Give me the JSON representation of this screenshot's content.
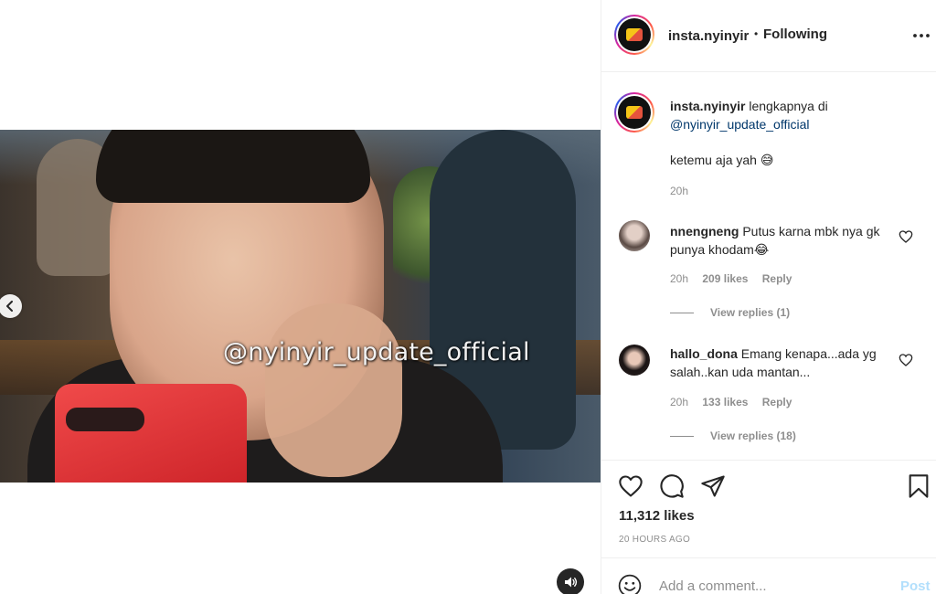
{
  "post": {
    "username": "insta.nyinyir",
    "following_label": "Following",
    "separator": "•",
    "video_watermark": "@nyinyir_update_official"
  },
  "caption": {
    "username": "insta.nyinyir",
    "text_before": "lengkapnya di",
    "mention": "@nyinyir_update_official",
    "line2": "ketemu aja yah 😅",
    "time": "20h"
  },
  "comments": [
    {
      "username": "nnengneng",
      "text": "Putus karna mbk nya gk punya khodam😂",
      "time": "20h",
      "likes": "209 likes",
      "reply_label": "Reply",
      "view_replies": "View replies (1)"
    },
    {
      "username": "hallo_dona",
      "text": "Emang kenapa...ada yg salah..kan uda mantan...",
      "time": "20h",
      "likes": "133 likes",
      "reply_label": "Reply",
      "view_replies": "View replies (18)"
    }
  ],
  "stats": {
    "likes": "11,312 likes",
    "time_ago": "20 HOURS AGO"
  },
  "add_comment": {
    "placeholder": "Add a comment...",
    "post_label": "Post"
  },
  "colors": {
    "link": "#00376b",
    "muted": "#8e8e8e",
    "post_disabled": "#b2dffc"
  },
  "icons": [
    "chevron-left-icon",
    "speaker-icon",
    "more-icon",
    "heart-icon",
    "comment-icon",
    "share-icon",
    "bookmark-icon",
    "emoji-icon"
  ]
}
